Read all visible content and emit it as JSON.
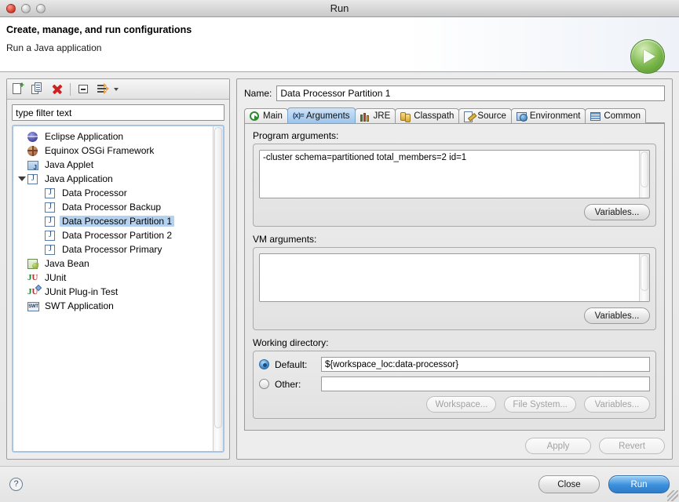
{
  "window": {
    "title": "Run",
    "traffic_lights": [
      "close",
      "minimize",
      "zoom"
    ]
  },
  "header": {
    "title": "Create, manage, and run configurations",
    "subtitle": "Run a Java application",
    "icon": "run-play-icon"
  },
  "left_panel": {
    "toolbar": [
      {
        "name": "new-configuration-icon",
        "tip": "New launch configuration"
      },
      {
        "name": "duplicate-configuration-icon",
        "tip": "Duplicate"
      },
      {
        "name": "delete-configuration-icon",
        "tip": "Delete"
      },
      {
        "name": "collapse-all-icon",
        "tip": "Collapse All"
      },
      {
        "name": "filter-icon",
        "tip": "Filter"
      }
    ],
    "filter": {
      "value": "type filter text",
      "placeholder": "type filter text"
    },
    "tree": [
      {
        "label": "Eclipse Application",
        "icon": "eclipse-icon",
        "depth": 0,
        "expandable": false,
        "selected": false
      },
      {
        "label": "Equinox OSGi Framework",
        "icon": "equinox-icon",
        "depth": 0,
        "expandable": false,
        "selected": false
      },
      {
        "label": "Java Applet",
        "icon": "java-applet-icon",
        "depth": 0,
        "expandable": false,
        "selected": false
      },
      {
        "label": "Java Application",
        "icon": "java-icon",
        "depth": 0,
        "expandable": true,
        "expanded": true,
        "selected": false
      },
      {
        "label": "Data Processor",
        "icon": "java-icon",
        "depth": 1,
        "expandable": false,
        "selected": false
      },
      {
        "label": "Data Processor Backup",
        "icon": "java-icon",
        "depth": 1,
        "expandable": false,
        "selected": false
      },
      {
        "label": "Data Processor Partition 1",
        "icon": "java-icon",
        "depth": 1,
        "expandable": false,
        "selected": true
      },
      {
        "label": "Data Processor Partition 2",
        "icon": "java-icon",
        "depth": 1,
        "expandable": false,
        "selected": false
      },
      {
        "label": "Data Processor Primary",
        "icon": "java-icon",
        "depth": 1,
        "expandable": false,
        "selected": false
      },
      {
        "label": "Java Bean",
        "icon": "java-bean-icon",
        "depth": 0,
        "expandable": false,
        "selected": false
      },
      {
        "label": "JUnit",
        "icon": "junit-icon",
        "depth": 0,
        "expandable": false,
        "selected": false
      },
      {
        "label": "JUnit Plug-in Test",
        "icon": "junit-plugin-icon",
        "depth": 0,
        "expandable": false,
        "selected": false
      },
      {
        "label": "SWT Application",
        "icon": "swt-icon",
        "depth": 0,
        "expandable": false,
        "selected": false
      }
    ]
  },
  "right_panel": {
    "name_label": "Name:",
    "name_value": "Data Processor Partition 1",
    "tabs": [
      {
        "label": "Main",
        "icon": "main-run-icon",
        "active": false
      },
      {
        "label": "Arguments",
        "icon": "arguments-icon",
        "active": true
      },
      {
        "label": "JRE",
        "icon": "jre-books-icon",
        "active": false
      },
      {
        "label": "Classpath",
        "icon": "classpath-icon",
        "active": false
      },
      {
        "label": "Source",
        "icon": "source-icon",
        "active": false
      },
      {
        "label": "Environment",
        "icon": "environment-icon",
        "active": false
      },
      {
        "label": "Common",
        "icon": "common-icon",
        "active": false
      }
    ],
    "program_arguments": {
      "label": "Program arguments:",
      "value": "-cluster schema=partitioned total_members=2 id=1",
      "variables_button": "Variables..."
    },
    "vm_arguments": {
      "label": "VM arguments:",
      "value": "",
      "variables_button": "Variables..."
    },
    "working_directory": {
      "label": "Working directory:",
      "default_label": "Default:",
      "default_value": "${workspace_loc:data-processor}",
      "default_selected": true,
      "other_label": "Other:",
      "other_value": "",
      "other_selected": false,
      "workspace_button": "Workspace...",
      "filesystem_button": "File System...",
      "variables_button": "Variables..."
    },
    "apply_button": "Apply",
    "revert_button": "Revert"
  },
  "footer": {
    "help_icon": "help-icon",
    "close_button": "Close",
    "run_button": "Run"
  },
  "colors": {
    "accent_blue": "#3b8fdc",
    "selection_blue": "#b4d2ef",
    "tab_active": "#9cc4ea",
    "run_green": "#7ab64a",
    "delete_red": "#cc2222"
  }
}
